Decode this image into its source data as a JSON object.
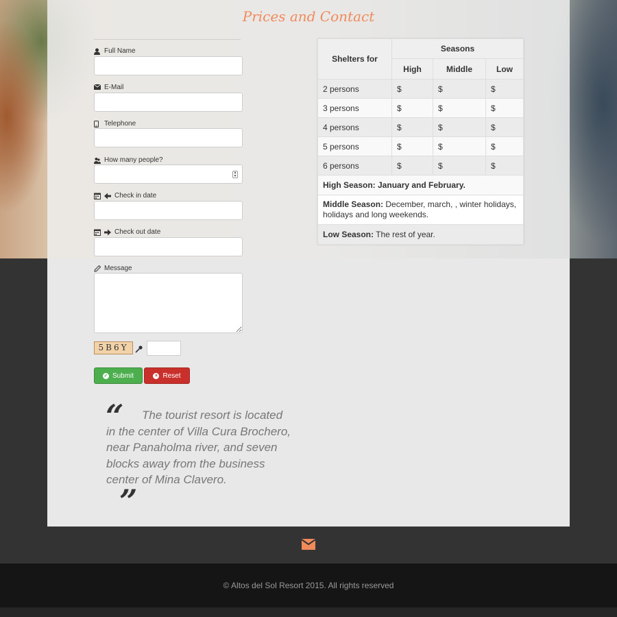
{
  "title": "Prices and Contact",
  "form": {
    "full_name_label": "Full Name",
    "email_label": "E-Mail",
    "telephone_label": "Telephone",
    "people_label": "How many people?",
    "checkin_label": "Check in date",
    "checkout_label": "Check out date",
    "message_label": "Message",
    "captcha_text": "5B6Y",
    "submit_label": "Submit",
    "reset_label": "Reset"
  },
  "table": {
    "header_shelters": "Shelters for",
    "header_seasons": "Seasons",
    "season_cols": [
      "High",
      "Middle",
      "Low"
    ],
    "rows": [
      {
        "label": "2 persons",
        "high": "$",
        "middle": "$",
        "low": "$"
      },
      {
        "label": "3 persons",
        "high": "$",
        "middle": "$",
        "low": "$"
      },
      {
        "label": "4 persons",
        "high": "$",
        "middle": "$",
        "low": "$"
      },
      {
        "label": "5 persons",
        "high": "$",
        "middle": "$",
        "low": "$"
      },
      {
        "label": "6 persons",
        "high": "$",
        "middle": "$",
        "low": "$"
      }
    ],
    "high_season_title": "High Season: January and February.",
    "middle_season_title": "Middle Season:",
    "middle_season_text": " December, march, , winter holidays, holidays and long weekends.",
    "low_season_title": "Low Season:",
    "low_season_text": " The rest of year."
  },
  "quote": {
    "open_mark": "“",
    "close_mark": "”",
    "text": "The tourist resort is located in the center of Villa Cura Brochero, near Panaholma river, and seven blocks away from the business center of Mina Clavero."
  },
  "footer": {
    "copyright": "© Altos del Sol Resort 2015. All rights reserved"
  },
  "colors": {
    "accent": "#f08a5a",
    "submit": "#4cae4c",
    "reset": "#c9302c"
  }
}
